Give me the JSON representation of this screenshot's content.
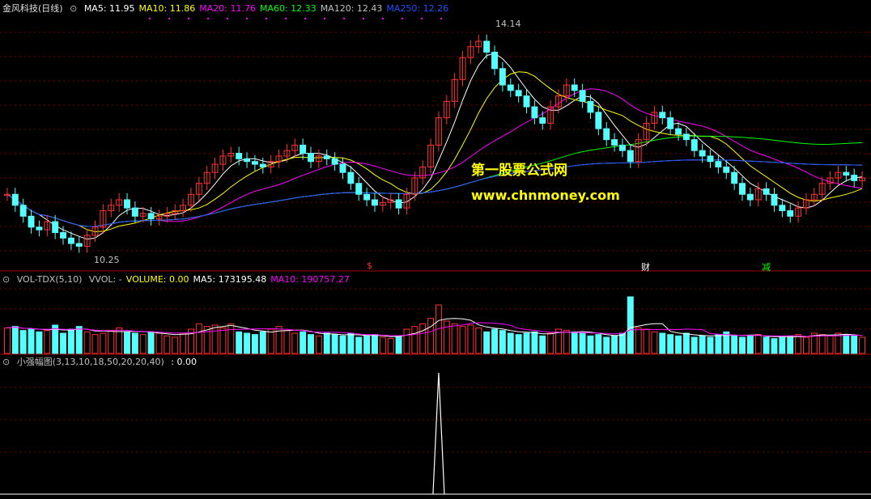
{
  "main": {
    "title": "金风科技(日线)",
    "indicators": [
      {
        "label": "MA5: 11.95",
        "color": "#ffffff"
      },
      {
        "label": "MA10: 11.86",
        "color": "#ffff00"
      },
      {
        "label": "MA20: 11.76",
        "color": "#ff00ff"
      },
      {
        "label": "MA60: 12.33",
        "color": "#00ff00"
      },
      {
        "label": "MA120: 12.43",
        "color": "#c0c0c0"
      },
      {
        "label": "MA250: 12.26",
        "color": "#1e50ff"
      }
    ],
    "high_label": "14.14",
    "low_label": "10.25",
    "markers": [
      {
        "text": "$",
        "color": "#ff3030"
      },
      {
        "text": "财",
        "color": "#ffffff"
      },
      {
        "text": "减",
        "color": "#00ff00"
      }
    ]
  },
  "watermark": {
    "line1": "第一股票公式网",
    "line2": "www.chnmoney.com"
  },
  "volume_pane": {
    "title": "VOL-TDX(5,10)",
    "items": [
      {
        "label": "VVOL: -",
        "color": "#c0c0c0"
      },
      {
        "label": "VOLUME: 0.00",
        "color": "#ffff00"
      },
      {
        "label": "MA5: 173195.48",
        "color": "#ffffff"
      },
      {
        "label": "MA10: 190757.27",
        "color": "#ff00ff"
      }
    ]
  },
  "indicator_pane": {
    "title": "小强幅图(3,13,10,18,50,20,20,40)",
    "value": ": 0.00"
  },
  "chart_data": {
    "type": "candlestick",
    "price_high": 14.14,
    "price_low": 10.25,
    "ma_values": {
      "MA5": 11.95,
      "MA10": 11.86,
      "MA20": 11.76,
      "MA60": 12.33,
      "MA120": 12.43,
      "MA250": 12.26
    },
    "closes": [
      11.2,
      11.0,
      10.8,
      10.6,
      10.55,
      10.7,
      10.5,
      10.4,
      10.3,
      10.25,
      10.45,
      10.6,
      10.9,
      11.0,
      11.1,
      10.95,
      10.8,
      10.85,
      10.75,
      10.8,
      10.85,
      10.9,
      11.0,
      11.2,
      11.4,
      11.6,
      11.75,
      11.9,
      11.95,
      11.85,
      11.8,
      11.75,
      11.7,
      11.8,
      11.9,
      12.0,
      12.1,
      11.95,
      11.8,
      11.9,
      11.85,
      11.75,
      11.6,
      11.4,
      11.2,
      11.1,
      11.0,
      11.05,
      11.1,
      10.95,
      11.2,
      11.5,
      11.7,
      12.1,
      12.6,
      12.9,
      13.3,
      13.7,
      13.9,
      14.0,
      13.8,
      13.5,
      13.2,
      13.1,
      13.0,
      12.8,
      12.6,
      12.5,
      12.8,
      13.0,
      13.2,
      13.1,
      12.9,
      12.7,
      12.4,
      12.2,
      12.1,
      12.0,
      11.8,
      12.2,
      12.5,
      12.7,
      12.6,
      12.4,
      12.3,
      12.2,
      12.0,
      11.9,
      11.8,
      11.7,
      11.6,
      11.4,
      11.2,
      11.1,
      11.3,
      11.2,
      11.0,
      10.9,
      10.8,
      10.95,
      11.1,
      11.2,
      11.4,
      11.5,
      11.6,
      11.55,
      11.45,
      11.5
    ],
    "volumes": [
      1.9,
      2.0,
      1.7,
      1.8,
      1.6,
      1.7,
      2.1,
      1.5,
      1.8,
      2.0,
      1.6,
      1.4,
      1.5,
      1.7,
      1.9,
      1.6,
      1.5,
      1.4,
      1.6,
      1.5,
      1.3,
      1.2,
      1.5,
      1.8,
      2.2,
      2.0,
      2.1,
      1.9,
      2.2,
      1.6,
      1.5,
      1.4,
      1.6,
      1.8,
      2.0,
      1.7,
      1.5,
      1.6,
      1.4,
      1.3,
      1.5,
      1.4,
      1.3,
      1.5,
      1.2,
      1.3,
      1.4,
      1.2,
      1.1,
      1.3,
      1.8,
      2.0,
      2.2,
      2.6,
      3.6,
      2.4,
      2.2,
      2.0,
      2.1,
      1.9,
      1.6,
      1.8,
      1.7,
      1.5,
      1.4,
      1.5,
      1.6,
      1.3,
      1.5,
      1.8,
      1.7,
      1.6,
      1.5,
      1.3,
      1.4,
      1.2,
      1.3,
      1.5,
      4.2,
      1.9,
      1.8,
      1.6,
      1.5,
      1.4,
      1.3,
      1.5,
      1.2,
      1.3,
      1.2,
      1.4,
      1.6,
      1.3,
      1.2,
      1.3,
      1.4,
      1.2,
      1.1,
      1.2,
      1.3,
      1.4,
      1.2,
      1.5,
      1.4,
      1.3,
      1.5,
      1.4,
      1.3,
      1.2
    ],
    "indicator_spike_at": 54
  }
}
